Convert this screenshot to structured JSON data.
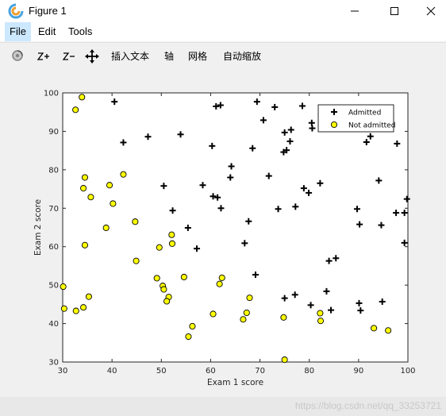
{
  "window": {
    "title": "Figure 1"
  },
  "menu": {
    "file": "File",
    "edit": "Edit",
    "tools": "Tools"
  },
  "toolbar": {
    "insert_text": "插入文本",
    "axis": "轴",
    "grid": "网格",
    "autoscale": "自动缩放"
  },
  "watermark": "https://blog.csdn.net/qq_33253721",
  "colors": {
    "admitted": "#000000",
    "not_admitted_fill": "#ffff00",
    "not_admitted_edge": "#000000"
  },
  "chart_data": {
    "type": "scatter",
    "title": "",
    "xlabel": "Exam 1 score",
    "ylabel": "Exam 2 score",
    "xlim": [
      30,
      100
    ],
    "ylim": [
      30,
      100
    ],
    "xticks": [
      30,
      40,
      50,
      60,
      70,
      80,
      90,
      100
    ],
    "yticks": [
      30,
      40,
      50,
      60,
      70,
      80,
      90,
      100
    ],
    "grid": false,
    "legend_position": "top-right",
    "series": [
      {
        "name": "Admitted",
        "marker": "plus",
        "points": [
          [
            40.5,
            97.7
          ],
          [
            61.1,
            96.5
          ],
          [
            62.0,
            96.8
          ],
          [
            69.4,
            97.7
          ],
          [
            73.0,
            96.3
          ],
          [
            78.6,
            96.6
          ],
          [
            42.3,
            87.1
          ],
          [
            47.3,
            88.6
          ],
          [
            53.9,
            89.2
          ],
          [
            70.7,
            92.9
          ],
          [
            80.5,
            92.2
          ],
          [
            76.1,
            87.4
          ],
          [
            91.6,
            87.2
          ],
          [
            92.4,
            88.7
          ],
          [
            75.0,
            89.7
          ],
          [
            76.3,
            90.4
          ],
          [
            97.8,
            86.8
          ],
          [
            60.3,
            86.2
          ],
          [
            68.5,
            85.6
          ],
          [
            75.4,
            85.1
          ],
          [
            74.8,
            84.6
          ],
          [
            80.6,
            90.8
          ],
          [
            64.2,
            80.9
          ],
          [
            64.0,
            78.0
          ],
          [
            71.8,
            78.4
          ],
          [
            50.5,
            75.8
          ],
          [
            58.4,
            76.0
          ],
          [
            60.5,
            73.1
          ],
          [
            61.4,
            72.8
          ],
          [
            52.3,
            69.4
          ],
          [
            62.1,
            70.0
          ],
          [
            67.7,
            66.6
          ],
          [
            73.7,
            69.8
          ],
          [
            77.2,
            70.4
          ],
          [
            78.9,
            75.2
          ],
          [
            79.9,
            74.0
          ],
          [
            82.2,
            76.5
          ],
          [
            89.7,
            69.8
          ],
          [
            90.2,
            65.8
          ],
          [
            94.1,
            77.2
          ],
          [
            94.6,
            65.6
          ],
          [
            97.6,
            68.8
          ],
          [
            99.3,
            68.8
          ],
          [
            99.8,
            72.4
          ],
          [
            55.4,
            64.9
          ],
          [
            57.2,
            59.5
          ],
          [
            66.9,
            60.9
          ],
          [
            99.3,
            61.0
          ],
          [
            69.1,
            52.7
          ],
          [
            75.0,
            46.6
          ],
          [
            77.1,
            47.5
          ],
          [
            80.3,
            44.8
          ],
          [
            83.5,
            48.4
          ],
          [
            84.0,
            56.3
          ],
          [
            85.4,
            57.0
          ],
          [
            84.4,
            43.5
          ],
          [
            90.1,
            45.3
          ],
          [
            90.4,
            43.4
          ],
          [
            94.8,
            45.7
          ]
        ]
      },
      {
        "name": "Not admitted",
        "marker": "circle",
        "points": [
          [
            33.9,
            98.9
          ],
          [
            32.6,
            95.6
          ],
          [
            42.3,
            78.8
          ],
          [
            34.5,
            78.0
          ],
          [
            34.2,
            75.2
          ],
          [
            35.7,
            72.9
          ],
          [
            39.5,
            76.0
          ],
          [
            40.2,
            71.2
          ],
          [
            44.7,
            66.5
          ],
          [
            38.8,
            64.9
          ],
          [
            34.5,
            60.4
          ],
          [
            44.9,
            56.3
          ],
          [
            49.6,
            59.8
          ],
          [
            52.2,
            60.8
          ],
          [
            52.1,
            63.1
          ],
          [
            30.1,
            49.6
          ],
          [
            35.3,
            47.0
          ],
          [
            30.3,
            43.9
          ],
          [
            32.7,
            43.3
          ],
          [
            34.2,
            44.2
          ],
          [
            49.1,
            51.8
          ],
          [
            50.3,
            49.8
          ],
          [
            50.5,
            48.9
          ],
          [
            51.5,
            46.9
          ],
          [
            51.1,
            45.8
          ],
          [
            54.6,
            52.1
          ],
          [
            61.8,
            50.3
          ],
          [
            62.3,
            51.9
          ],
          [
            55.5,
            36.6
          ],
          [
            56.3,
            39.3
          ],
          [
            60.5,
            42.5
          ],
          [
            66.6,
            41.1
          ],
          [
            67.3,
            42.8
          ],
          [
            67.9,
            46.7
          ],
          [
            74.8,
            41.6
          ],
          [
            75.0,
            30.6
          ],
          [
            82.2,
            42.7
          ],
          [
            82.3,
            40.7
          ],
          [
            93.1,
            38.8
          ],
          [
            96.0,
            38.2
          ]
        ]
      }
    ]
  }
}
